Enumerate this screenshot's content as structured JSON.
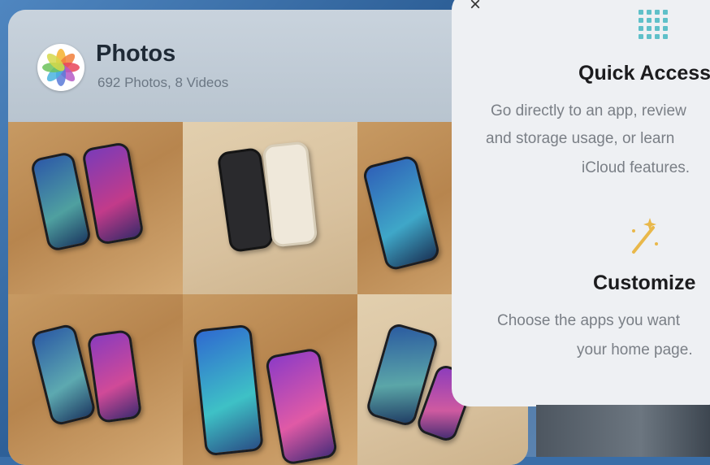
{
  "photos_widget": {
    "title": "Photos",
    "subtitle": "692 Photos, 8 Videos",
    "icon": "photos-app-icon",
    "tiles": [
      "phone-photo-1",
      "phone-photo-2",
      "phone-photo-3",
      "phone-photo-4",
      "phone-photo-5",
      "phone-photo-6"
    ]
  },
  "info_panel": {
    "close_label": "×",
    "sections": [
      {
        "icon": "grid-dots-icon",
        "title": "Quick Access",
        "lines": [
          "Go directly to an app, review",
          "and storage usage, or learn",
          "iCloud features."
        ]
      },
      {
        "icon": "magic-wand-icon",
        "title": "Customize",
        "lines": [
          "Choose the apps you want",
          "your home page."
        ]
      }
    ]
  },
  "colors": {
    "panel_bg": "#eef0f3",
    "title_text": "#1c1c1e",
    "desc_text": "#7a7f86",
    "grid_icon": "#5fc0c9",
    "wand_icon": "#e9b84a"
  }
}
